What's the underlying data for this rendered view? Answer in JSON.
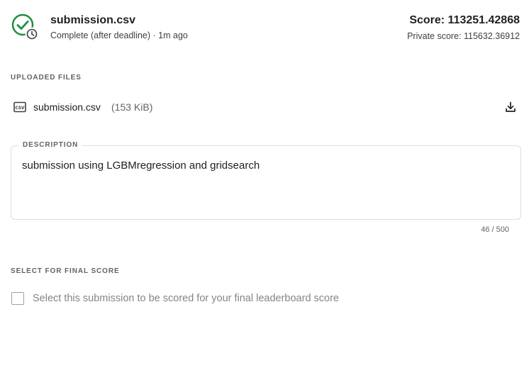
{
  "submission": {
    "file_name": "submission.csv",
    "status": "Complete (after deadline) · 1m ago",
    "score": "Score: 113251.42868",
    "private_score": "Private score: 115632.36912"
  },
  "uploaded_files": {
    "section_label": "UPLOADED FILES",
    "file_icon_text": "CSV",
    "file_name": "submission.csv",
    "file_size": "(153 KiB)"
  },
  "description": {
    "legend": "DESCRIPTION",
    "text": "submission using LGBMregression and gridsearch",
    "char_count": "46 / 500"
  },
  "final_score": {
    "section_label": "SELECT FOR FINAL SCORE",
    "checkbox_label": "Select this submission to be scored for your final leaderboard score",
    "checked": false
  },
  "icons": {
    "status": "check-with-clock-icon",
    "file": "csv-file-icon",
    "download": "download-icon"
  },
  "colors": {
    "success": "#1e8e3e",
    "text_primary": "#202124",
    "text_secondary": "#5f6368",
    "border": "#dadce0"
  }
}
